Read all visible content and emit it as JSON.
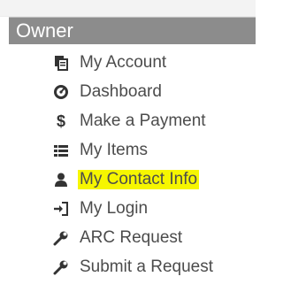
{
  "sidebar": {
    "section_title": "Owner",
    "items": [
      {
        "label": "My Account",
        "icon": "file-stack-icon"
      },
      {
        "label": "Dashboard",
        "icon": "tachometer-icon"
      },
      {
        "label": "Make a Payment",
        "icon": "dollar-icon"
      },
      {
        "label": "My Items",
        "icon": "list-icon"
      },
      {
        "label": "My Contact Info",
        "icon": "user-icon",
        "highlighted": true,
        "highlight_color": "#f6f600"
      },
      {
        "label": "My Login",
        "icon": "sign-in-icon"
      },
      {
        "label": "ARC Request",
        "icon": "wrench-icon"
      },
      {
        "label": "Submit a Request",
        "icon": "wrench-icon"
      }
    ]
  },
  "colors": {
    "header_bg": "#8c8c8c",
    "header_text": "#ffffff",
    "item_text": "#4c4c4c",
    "icon": "#333333"
  }
}
